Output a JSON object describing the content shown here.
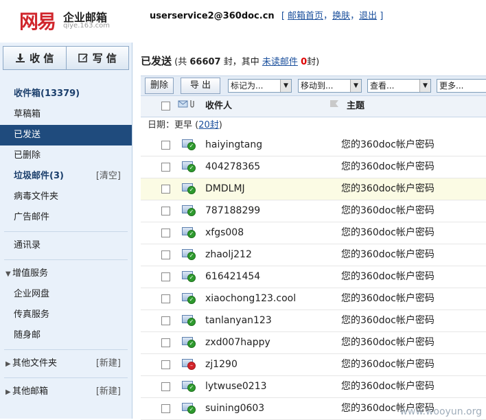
{
  "brand": {
    "logo_text": "网易",
    "product": "企业邮箱",
    "domain": "qiye.163.com"
  },
  "account": {
    "email": "userservice2@360doc.cn",
    "open_bracket": "[",
    "link_home": "邮箱首页",
    "sep1": "，",
    "link_skin": "换肤",
    "sep2": "，",
    "link_logout": "退出",
    "close_bracket": "]"
  },
  "sidebar": {
    "receive_label": "收 信",
    "compose_label": "写 信",
    "items": [
      {
        "label": "收件箱(13379)"
      },
      {
        "label": "草稿箱"
      },
      {
        "label": "已发送"
      },
      {
        "label": "已删除"
      },
      {
        "label": "垃圾邮件(3)",
        "right": "[清空]"
      },
      {
        "label": "病毒文件夹"
      },
      {
        "label": "广告邮件"
      },
      {
        "label": "通讯录"
      },
      {
        "label": "增值服务"
      },
      {
        "label": "企业网盘"
      },
      {
        "label": "传真服务"
      },
      {
        "label": "随身邮"
      },
      {
        "label": "其他文件夹",
        "right": "[新建]"
      },
      {
        "label": "其他邮箱",
        "right": "[新建]"
      }
    ]
  },
  "folder": {
    "title": "已发送",
    "pre": "(共",
    "total": "66607",
    "mid": "封，其中",
    "unread_link": "未读邮件",
    "unread_count": "0",
    "post": "封)"
  },
  "toolbar": {
    "delete": "删除",
    "export": "导 出",
    "mark_as": "标记为...",
    "move_to": "移动到...",
    "view": "查看...",
    "more": "更多..."
  },
  "columns": {
    "recipient": "收件人",
    "subject": "主题"
  },
  "date_group": {
    "label": "日期：",
    "value": "更早",
    "open": "(",
    "count_link": "20封",
    "close": ")"
  },
  "messages": [
    {
      "to": "haiyingtang",
      "subject": "您的360doc帐户密码",
      "status": "sent-green"
    },
    {
      "to": "404278365",
      "subject": "您的360doc帐户密码",
      "status": "sent-green"
    },
    {
      "to": "DMDLMJ",
      "subject": "您的360doc帐户密码",
      "status": "sent-green"
    },
    {
      "to": "787188299",
      "subject": "您的360doc帐户密码",
      "status": "sent-green"
    },
    {
      "to": "xfgs008",
      "subject": "您的360doc帐户密码",
      "status": "sent-green"
    },
    {
      "to": "zhaolj212",
      "subject": "您的360doc帐户密码",
      "status": "sent-green"
    },
    {
      "to": "616421454",
      "subject": "您的360doc帐户密码",
      "status": "sent-green"
    },
    {
      "to": "xiaochong123.cool",
      "subject": "您的360doc帐户密码",
      "status": "sent-green"
    },
    {
      "to": "tanlanyan123",
      "subject": "您的360doc帐户密码",
      "status": "sent-green"
    },
    {
      "to": "zxd007happy",
      "subject": "您的360doc帐户密码",
      "status": "sent-green"
    },
    {
      "to": "zj1290",
      "subject": "您的360doc帐户密码",
      "status": "failed-red"
    },
    {
      "to": "lytwuse0213",
      "subject": "您的360doc帐户密码",
      "status": "sent-green"
    },
    {
      "to": "suining0603",
      "subject": "您的360doc帐户密码",
      "status": "sent-green"
    }
  ],
  "watermark": "www.wooyun.org"
}
